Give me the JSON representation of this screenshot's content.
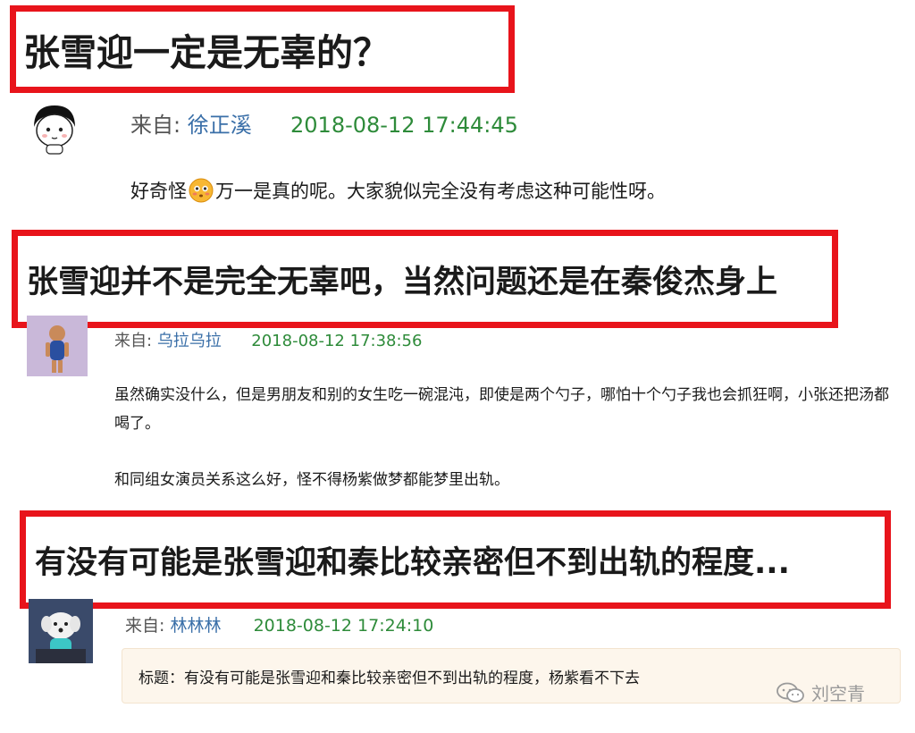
{
  "headline1": "张雪迎一定是无辜的？",
  "headline2": "张雪迎并不是完全无辜吧，当然问题还是在秦俊杰身上",
  "headline3": "有没有可能是张雪迎和秦比较亲密但不到出轨的程度...",
  "comments": [
    {
      "from_label": "来自:",
      "user": "徐正溪",
      "date": "2018-08-12 17:44:45",
      "text_before": "好奇怪",
      "emoji": "flushed-face",
      "text_after": "万一是真的呢。大家貌似完全没有考虑这种可能性呀。"
    },
    {
      "from_label": "来自:",
      "user": "乌拉乌拉",
      "date": "2018-08-12 17:38:56",
      "para1": "虽然确实没什么，但是男朋友和别的女生吃一碗混沌，即使是两个勺子，哪怕十个勺子我也会抓狂啊，小张还把汤都喝了。",
      "para2": "和同组女演员关系这么好，怪不得杨紫做梦都能梦里出轨。"
    },
    {
      "from_label": "来自:",
      "user": "林林林",
      "date": "2018-08-12 17:24:10",
      "quote": "标题：有没有可能是张雪迎和秦比较亲密但不到出轨的程度，杨紫看不下去"
    }
  ],
  "watermark": "刘空青",
  "colors": {
    "highlight": "#e8141b",
    "user": "#3a6fa8",
    "date": "#2e8b3a"
  }
}
